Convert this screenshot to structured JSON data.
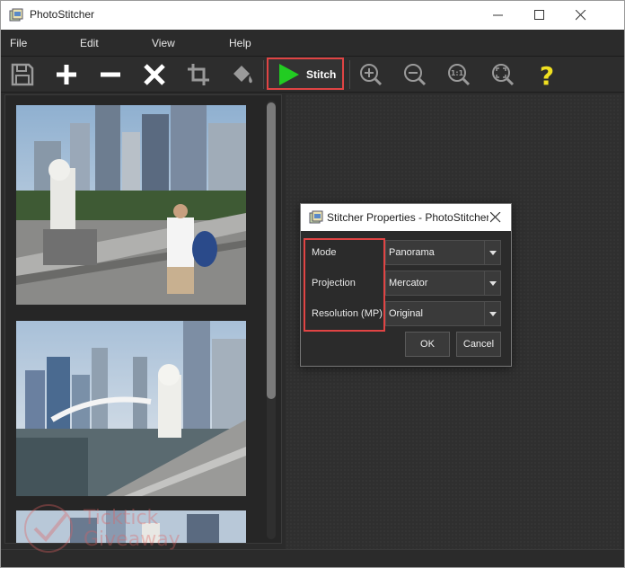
{
  "window": {
    "title": "PhotoStitcher"
  },
  "menu": {
    "items": [
      {
        "label": "File"
      },
      {
        "label": "Edit"
      },
      {
        "label": "View"
      },
      {
        "label": "Help"
      }
    ]
  },
  "toolbar": {
    "stitch_label": "Stitch",
    "icons": [
      "save-icon",
      "plus-icon",
      "minus-icon",
      "close-icon",
      "crop-icon",
      "fill-bucket-icon",
      "play-icon",
      "zoom-in-icon",
      "zoom-out-icon",
      "zoom-actual-icon",
      "zoom-fit-icon",
      "help-icon"
    ],
    "colors": {
      "stitch_play": "#22cc22",
      "help": "#f0e020",
      "highlight": "#e04444"
    }
  },
  "dialog": {
    "title": "Stitcher Properties - PhotoStitcher",
    "fields": [
      {
        "label": "Mode",
        "value": "Panorama"
      },
      {
        "label": "Projection",
        "value": "Mercator"
      },
      {
        "label": "Resolution (MP)",
        "value": "Original"
      }
    ],
    "ok_label": "OK",
    "cancel_label": "Cancel"
  },
  "watermark": {
    "line1": "Ticktick",
    "line2": "Giveaway"
  }
}
